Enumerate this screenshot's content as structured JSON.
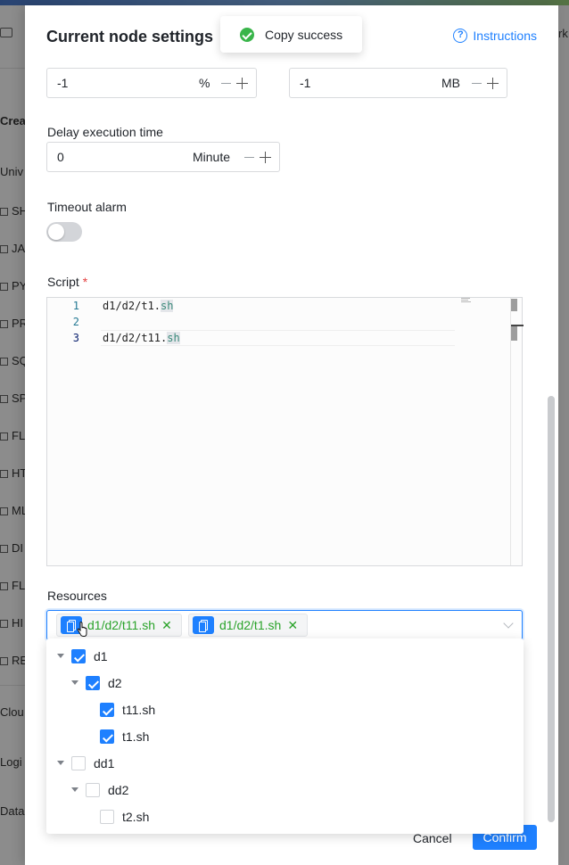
{
  "background": {
    "sidebar_items": [
      "SH",
      "JA",
      "PY",
      "PR",
      "SQ",
      "SP",
      "FL",
      "HT",
      "ML",
      "DI",
      "FL",
      "HI",
      "RE"
    ],
    "sidebar_headers": [
      "Crea",
      "Univ",
      "Clou",
      "Logi",
      "Data"
    ],
    "right_fragment": "rk"
  },
  "drawer": {
    "title": "Current node settings",
    "instructions_label": "Instructions",
    "cpu_quota": {
      "value": "-1",
      "unit": "%"
    },
    "memory_max": {
      "value": "-1",
      "unit": "MB"
    },
    "delay": {
      "label": "Delay execution time",
      "value": "0",
      "unit": "Minute"
    },
    "timeout": {
      "label": "Timeout alarm",
      "enabled": false
    },
    "script": {
      "label": "Script",
      "required_mark": "*",
      "lines": [
        {
          "num": "1",
          "prefix": "d1/d2/t1.",
          "ext": "sh"
        },
        {
          "num": "2",
          "prefix": "",
          "ext": ""
        },
        {
          "num": "3",
          "prefix": "d1/d2/t11.",
          "ext": "sh"
        }
      ]
    },
    "resources": {
      "label": "Resources",
      "tags": [
        "d1/d2/t11.sh",
        "d1/d2/t1.sh"
      ],
      "close_glyph": "✕",
      "tree": [
        {
          "label": "d1",
          "level": 0,
          "checked": true,
          "expandable": true
        },
        {
          "label": "d2",
          "level": 1,
          "checked": true,
          "expandable": true
        },
        {
          "label": "t11.sh",
          "level": 2,
          "checked": true,
          "expandable": false
        },
        {
          "label": "t1.sh",
          "level": 2,
          "checked": true,
          "expandable": false
        },
        {
          "label": "dd1",
          "level": 0,
          "checked": false,
          "expandable": true
        },
        {
          "label": "dd2",
          "level": 1,
          "checked": false,
          "expandable": true
        },
        {
          "label": "t2.sh",
          "level": 2,
          "checked": false,
          "expandable": false
        }
      ]
    },
    "cancel_label": "Cancel",
    "confirm_label": "Confirm"
  },
  "toast": {
    "message": "Copy success"
  },
  "colors": {
    "primary": "#1e80ff",
    "success": "#39b54a",
    "tag_text": "#2aa32a",
    "required": "#e43f3f"
  }
}
